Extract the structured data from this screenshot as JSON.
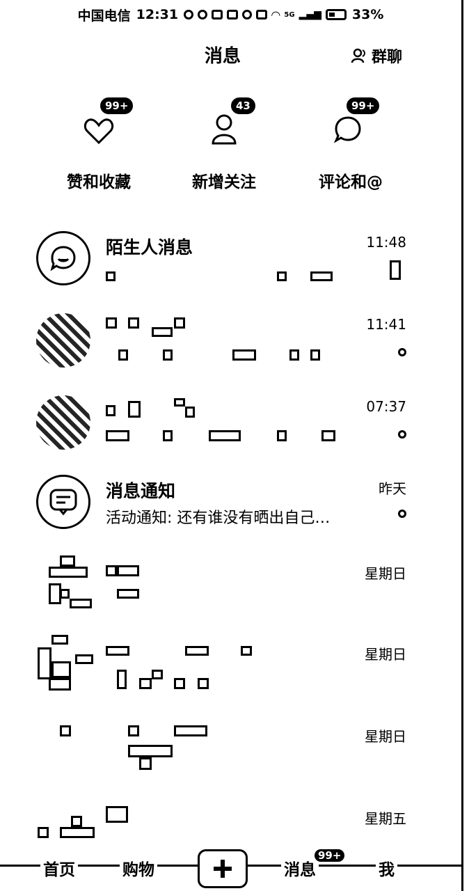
{
  "status_bar": {
    "carrier": "中国电信",
    "time": "12:31",
    "battery": "33%",
    "network": "5G"
  },
  "header": {
    "title": "消息",
    "group_chat_label": "群聊"
  },
  "categories": [
    {
      "label": "赞和收藏",
      "badge": "99+",
      "icon": "heart-icon"
    },
    {
      "label": "新增关注",
      "badge": "43",
      "icon": "person-icon"
    },
    {
      "label": "评论和@",
      "badge": "99+",
      "icon": "comment-icon"
    }
  ],
  "messages": [
    {
      "title": "陌生人消息",
      "time": "11:48",
      "preview": "",
      "avatar": "stranger-chat-icon",
      "unread": false
    },
    {
      "title": "",
      "time": "11:41",
      "preview": "",
      "avatar": "user-photo",
      "unread": true
    },
    {
      "title": "",
      "time": "07:37",
      "preview": "",
      "avatar": "user-photo",
      "unread": true
    },
    {
      "title": "消息通知",
      "time": "昨天",
      "preview": "活动通知: 还有谁没有晒出自己…",
      "avatar": "notification-icon",
      "unread": true
    },
    {
      "title": "",
      "time": "星期日",
      "preview": "",
      "avatar": "user-photo",
      "unread": false
    },
    {
      "title": "",
      "time": "星期日",
      "preview": "",
      "avatar": "user-photo",
      "unread": false
    },
    {
      "title": "",
      "time": "星期日",
      "preview": "",
      "avatar": "user-photo",
      "unread": false
    },
    {
      "title": "",
      "time": "星期五",
      "preview": "",
      "avatar": "user-photo",
      "unread": false
    }
  ],
  "bottom_nav": {
    "home": "首页",
    "shop": "购物",
    "messages": "消息",
    "messages_badge": "99+",
    "me": "我"
  }
}
